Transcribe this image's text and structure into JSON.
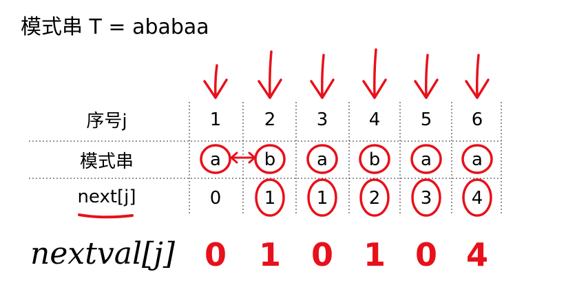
{
  "title": "模式串 T = ababaa",
  "rows": {
    "index_label": "序号j",
    "pattern_label": "模式串",
    "next_label": "next[j]"
  },
  "index": [
    "1",
    "2",
    "3",
    "4",
    "5",
    "6"
  ],
  "pattern": [
    "a",
    "b",
    "a",
    "b",
    "a",
    "a"
  ],
  "next": [
    "0",
    "1",
    "1",
    "2",
    "3",
    "4"
  ],
  "nextval_label": "nextval[j]",
  "nextval": [
    "0",
    "1",
    "0",
    "1",
    "0",
    "4"
  ],
  "colors": {
    "ink": "#000000",
    "annotation": "#e8101a",
    "rule": "#555555"
  }
}
